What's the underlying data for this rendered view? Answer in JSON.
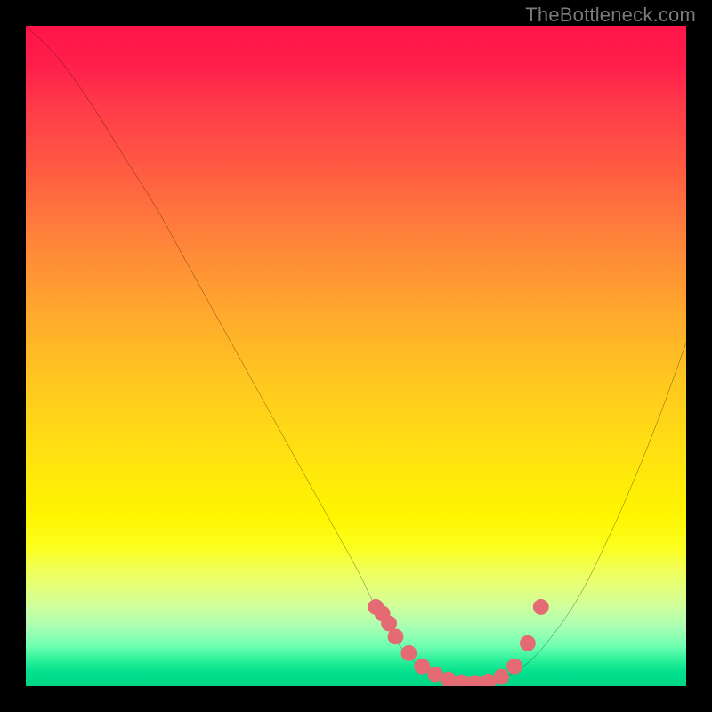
{
  "watermark": "TheBottleneck.com",
  "chart_data": {
    "type": "line",
    "title": "",
    "xlabel": "",
    "ylabel": "",
    "xlim": [
      0,
      100
    ],
    "ylim": [
      0,
      100
    ],
    "series": [
      {
        "name": "bottleneck-curve",
        "x": [
          0,
          5,
          10,
          15,
          20,
          25,
          30,
          35,
          40,
          45,
          50,
          53,
          56,
          59,
          62,
          65,
          68,
          72,
          76,
          80,
          84,
          88,
          92,
          96,
          100
        ],
        "y": [
          100,
          95,
          88,
          80,
          72,
          63,
          54,
          45,
          36,
          27,
          18,
          12,
          7,
          3.5,
          1.5,
          0.6,
          0.5,
          1.2,
          3.5,
          8,
          14,
          22,
          31,
          41,
          52
        ]
      }
    ],
    "markers": {
      "name": "highlight-dots",
      "color": "#e46a73",
      "radius": 1.2,
      "points_x": [
        53,
        54,
        55,
        56,
        58,
        60,
        62,
        64,
        66,
        68,
        70,
        72,
        74,
        76,
        78
      ],
      "points_y": [
        12,
        11,
        9.5,
        7.5,
        5,
        3,
        1.8,
        1,
        0.6,
        0.5,
        0.7,
        1.4,
        3,
        6.5,
        12
      ]
    },
    "gradient_stops": [
      {
        "pos": 0.0,
        "color": "#ff1549"
      },
      {
        "pos": 0.2,
        "color": "#ff5543"
      },
      {
        "pos": 0.5,
        "color": "#ffc81f"
      },
      {
        "pos": 0.75,
        "color": "#fff500"
      },
      {
        "pos": 0.9,
        "color": "#a9ffb4"
      },
      {
        "pos": 1.0,
        "color": "#00d684"
      }
    ]
  }
}
